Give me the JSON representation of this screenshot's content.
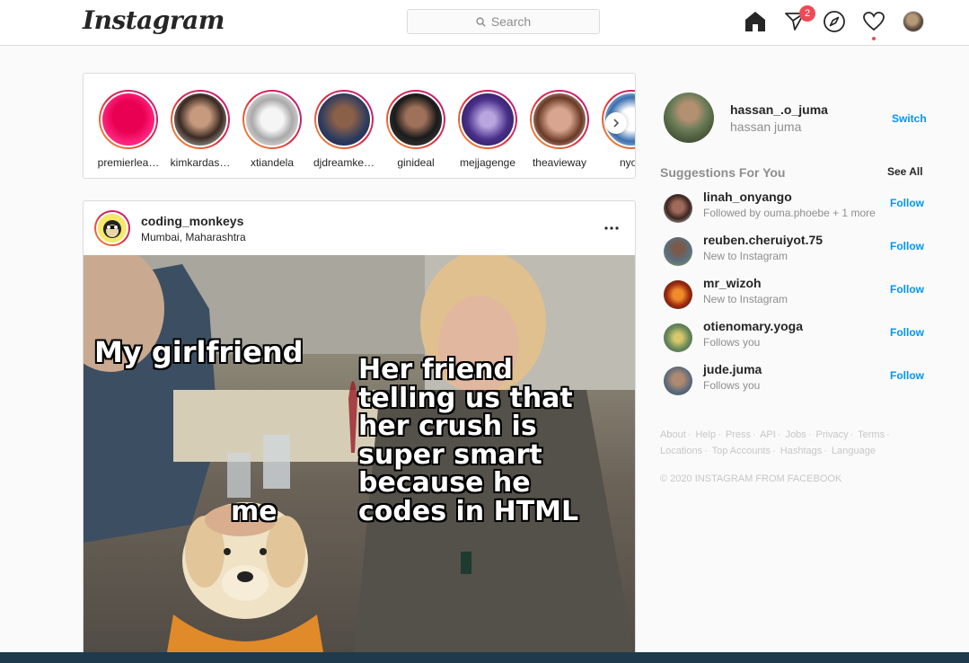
{
  "header": {
    "logo": "Instagram",
    "search_placeholder": "Search",
    "direct_badge": "2"
  },
  "stories": [
    {
      "name": "premierlea…"
    },
    {
      "name": "kimkardas…"
    },
    {
      "name": "xtiandela"
    },
    {
      "name": "djdreamke…"
    },
    {
      "name": "ginideal"
    },
    {
      "name": "mejjagenge"
    },
    {
      "name": "theavieway"
    },
    {
      "name": "nyon"
    }
  ],
  "post": {
    "username": "coding_monkeys",
    "location": "Mumbai, Maharashtra",
    "meme": {
      "top_left": "My girlfriend",
      "right": "Her friend telling us that her crush is super smart because he codes in HTML",
      "bottom": "me"
    }
  },
  "profile": {
    "username": "hassan_.o_juma",
    "name": "hassan juma",
    "switch_label": "Switch"
  },
  "suggestions": {
    "title": "Suggestions For You",
    "see_all": "See All",
    "follow_label": "Follow",
    "items": [
      {
        "username": "linah_onyango",
        "subtitle": "Followed by ouma.phoebe + 1 more"
      },
      {
        "username": "reuben.cheruiyot.75",
        "subtitle": "New to Instagram"
      },
      {
        "username": "mr_wizoh",
        "subtitle": "New to Instagram"
      },
      {
        "username": "otienomary.yoga",
        "subtitle": "Follows you"
      },
      {
        "username": "jude.juma",
        "subtitle": "Follows you"
      }
    ]
  },
  "footer": {
    "links": [
      "About",
      "Help",
      "Press",
      "API",
      "Jobs",
      "Privacy",
      "Terms",
      "Locations",
      "Top Accounts",
      "Hashtags",
      "Language"
    ],
    "copyright": "© 2020 Instagram from Facebook"
  }
}
